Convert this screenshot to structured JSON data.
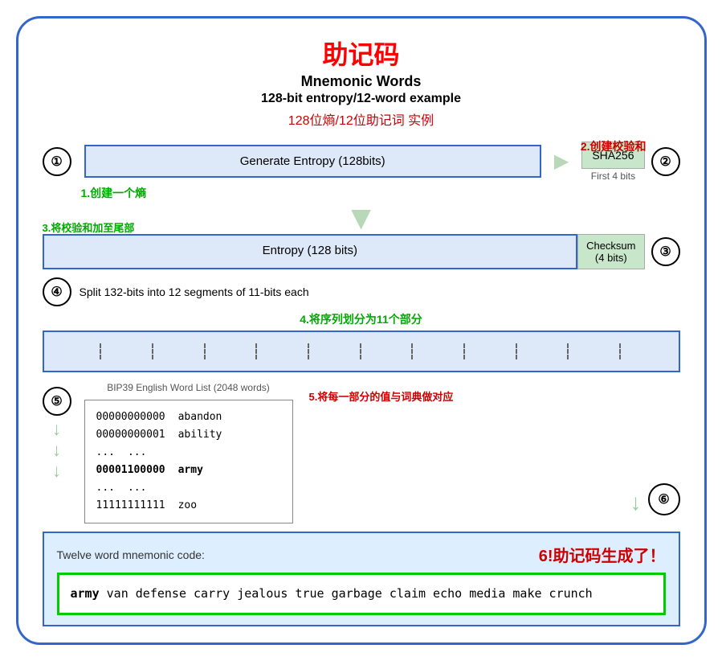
{
  "title_zh": "助记码",
  "title_en": "Mnemonic Words",
  "subtitle_en": "128-bit entropy/12-word example",
  "subtitle_zh": "128位熵/12位助记词 实例",
  "step1": {
    "circle": "①",
    "label": "Generate Entropy (128bits)",
    "annotation": "1.创建一个熵"
  },
  "step2": {
    "circle": "②",
    "annotation": "2.创建校验和",
    "sha_label": "SHA256",
    "first4bits": "First 4 bits"
  },
  "step3": {
    "circle": "③",
    "annotation": "3.将校验和加至尾部",
    "entropy_label": "Entropy (128 bits)",
    "checksum_label": "Checksum",
    "checksum_bits": "(4 bits)"
  },
  "step4": {
    "circle": "④",
    "label": "Split 132-bits into 12 segments of 11-bits each",
    "annotation": "4.将序列划分为11个部分",
    "segments": 12
  },
  "step5": {
    "circle": "⑤",
    "annotation": "5.将每一部分的值与词典做对应",
    "wordlist_title": "BIP39 English Word List (2048 words)",
    "entries": [
      {
        "binary": "00000000000",
        "word": "abandon"
      },
      {
        "binary": "00000000001",
        "word": "ability"
      },
      {
        "binary": "...",
        "word": "..."
      },
      {
        "binary": "00001100000",
        "word": "army",
        "bold": true
      },
      {
        "binary": "...",
        "word": "..."
      },
      {
        "binary": "11111111111",
        "word": "zoo"
      }
    ]
  },
  "step6": {
    "circle": "⑥",
    "annotation": "6!助记码生成了！"
  },
  "mnemonic": {
    "label": "Twelve word mnemonic code:",
    "bold_word": "army",
    "rest_words": " van defense carry jealous true garbage claim echo media make crunch"
  }
}
